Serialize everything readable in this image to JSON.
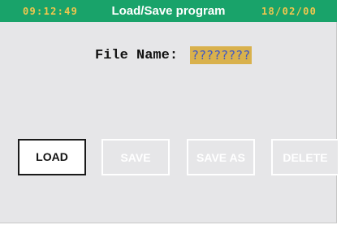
{
  "header": {
    "time": "09:12:49",
    "title": "Load/Save program",
    "date": "18/02/00"
  },
  "file_name": {
    "label": "File Name:",
    "value": "????????"
  },
  "buttons": {
    "load": "LOAD",
    "save": "SAVE",
    "save_as": "SAVE AS",
    "delete": "DELETE"
  },
  "colors": {
    "header_bg": "#19a36a",
    "header_clock": "#f3c74d",
    "panel_bg": "#e6e6e8",
    "field_bg": "#d9b14c",
    "field_text": "#3d57c7"
  }
}
